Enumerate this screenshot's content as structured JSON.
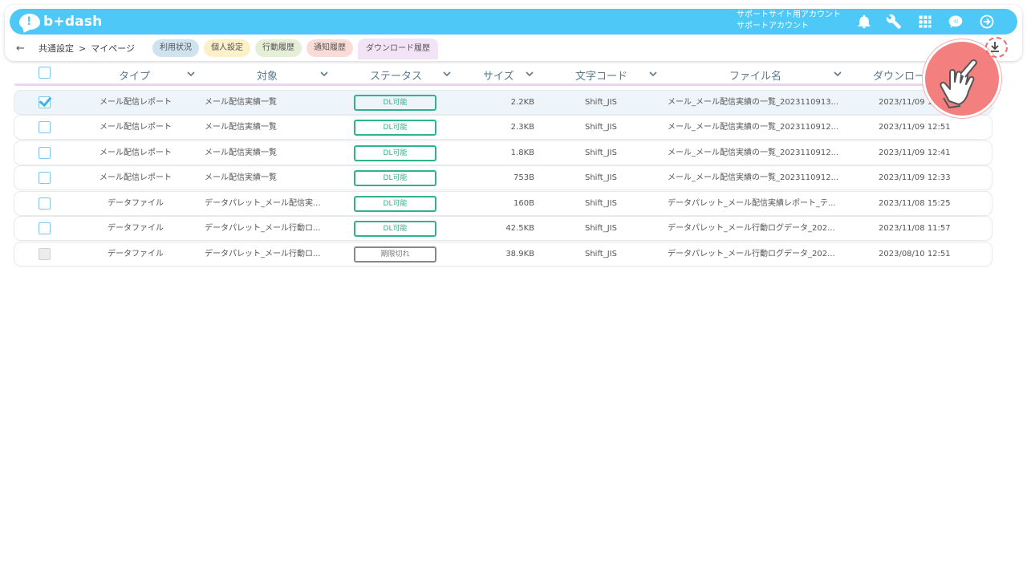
{
  "header": {
    "logo_text": "b+dash",
    "account_line1": "サポートサイト用アカウント",
    "account_line2": "サポートアカウント",
    "icons": [
      "bell-icon",
      "wrench-icon",
      "grid-icon",
      "chat-icon",
      "logout-icon"
    ],
    "accent_color": "#4dc8f7"
  },
  "subnav": {
    "back_icon": "←",
    "crumb_1": "共通設定",
    "separator": ">",
    "crumb_2": "マイページ",
    "tabs": [
      {
        "label": "利用状況"
      },
      {
        "label": "個人設定"
      },
      {
        "label": "行動履歴"
      },
      {
        "label": "通知履歴"
      },
      {
        "label": "ダウンロード履歴"
      }
    ]
  },
  "table": {
    "columns": [
      "タイプ",
      "対象",
      "ステータス",
      "サイズ",
      "文字コード",
      "ファイル名",
      "ダウンロー"
    ],
    "rows": [
      {
        "checked": true,
        "disabled": false,
        "type": "メール配信レポート",
        "target": "メール配信実績一覧",
        "status": "DL可能",
        "size": "2.2KB",
        "encoding": "Shift_JIS",
        "filename": "メール_メール配信実績の一覧_2023110913...",
        "date": "2023/11/09 1"
      },
      {
        "checked": false,
        "disabled": false,
        "type": "メール配信レポート",
        "target": "メール配信実績一覧",
        "status": "DL可能",
        "size": "2.3KB",
        "encoding": "Shift_JIS",
        "filename": "メール_メール配信実績の一覧_2023110912...",
        "date": "2023/11/09 12:51"
      },
      {
        "checked": false,
        "disabled": false,
        "type": "メール配信レポート",
        "target": "メール配信実績一覧",
        "status": "DL可能",
        "size": "1.8KB",
        "encoding": "Shift_JIS",
        "filename": "メール_メール配信実績の一覧_2023110912...",
        "date": "2023/11/09 12:41"
      },
      {
        "checked": false,
        "disabled": false,
        "type": "メール配信レポート",
        "target": "メール配信実績一覧",
        "status": "DL可能",
        "size": "753B",
        "encoding": "Shift_JIS",
        "filename": "メール_メール配信実績の一覧_2023110912...",
        "date": "2023/11/09 12:33"
      },
      {
        "checked": false,
        "disabled": false,
        "type": "データファイル",
        "target": "データパレット_メール配信実...",
        "status": "DL可能",
        "size": "160B",
        "encoding": "Shift_JIS",
        "filename": "データパレット_メール配信実績レポート_テ...",
        "date": "2023/11/08 15:25"
      },
      {
        "checked": false,
        "disabled": false,
        "type": "データファイル",
        "target": "データパレット_メール行動ロ...",
        "status": "DL可能",
        "size": "42.5KB",
        "encoding": "Shift_JIS",
        "filename": "データパレット_メール行動ログデータ_202...",
        "date": "2023/11/08 11:57"
      },
      {
        "checked": false,
        "disabled": true,
        "type": "データファイル",
        "target": "データパレット_メール行動ロ...",
        "status": "期限切れ",
        "size": "38.9KB",
        "encoding": "Shift_JIS",
        "filename": "データパレット_メール行動ログデータ_202...",
        "date": "2023/08/10 12:51"
      }
    ]
  },
  "colors": {
    "status_ok": "#2eb38a",
    "status_expired": "#888888",
    "pointer_circle": "#f37f7f"
  }
}
